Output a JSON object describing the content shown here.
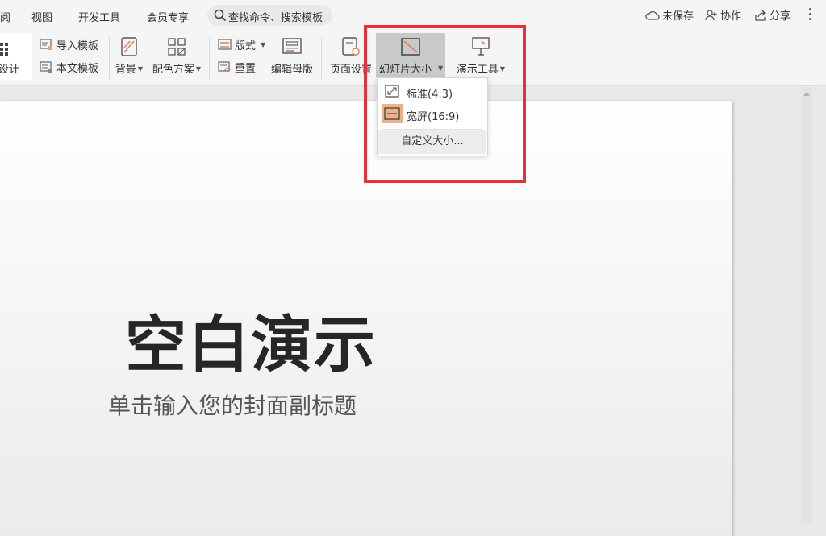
{
  "menubar": {
    "items": [
      "阅",
      "视图",
      "开发工具",
      "会员专享"
    ],
    "search_placeholder": "查找命令、搜索模板",
    "unsaved": "未保存",
    "collaborate": "协作",
    "share": "分享"
  },
  "ribbon": {
    "design": "设计",
    "import_template": "导入模板",
    "this_template": "本文模板",
    "background": "背景",
    "color_scheme": "配色方案",
    "layout": "版式",
    "reset": "重置",
    "edit_master": "编辑母版",
    "page_setup": "页面设置",
    "slide_size": "幻灯片大小",
    "present_tools": "演示工具"
  },
  "dropdown": {
    "standard": "标准(4:3)",
    "widescreen": "宽屏(16:9)",
    "custom": "自定义大小..."
  },
  "slide": {
    "title": "空白演示",
    "subtitle": "单击输入您的封面副标题"
  },
  "colors": {
    "highlight": "#e8303a",
    "active_button": "#c9c9c9",
    "selected_icon": "#f0b08a"
  }
}
